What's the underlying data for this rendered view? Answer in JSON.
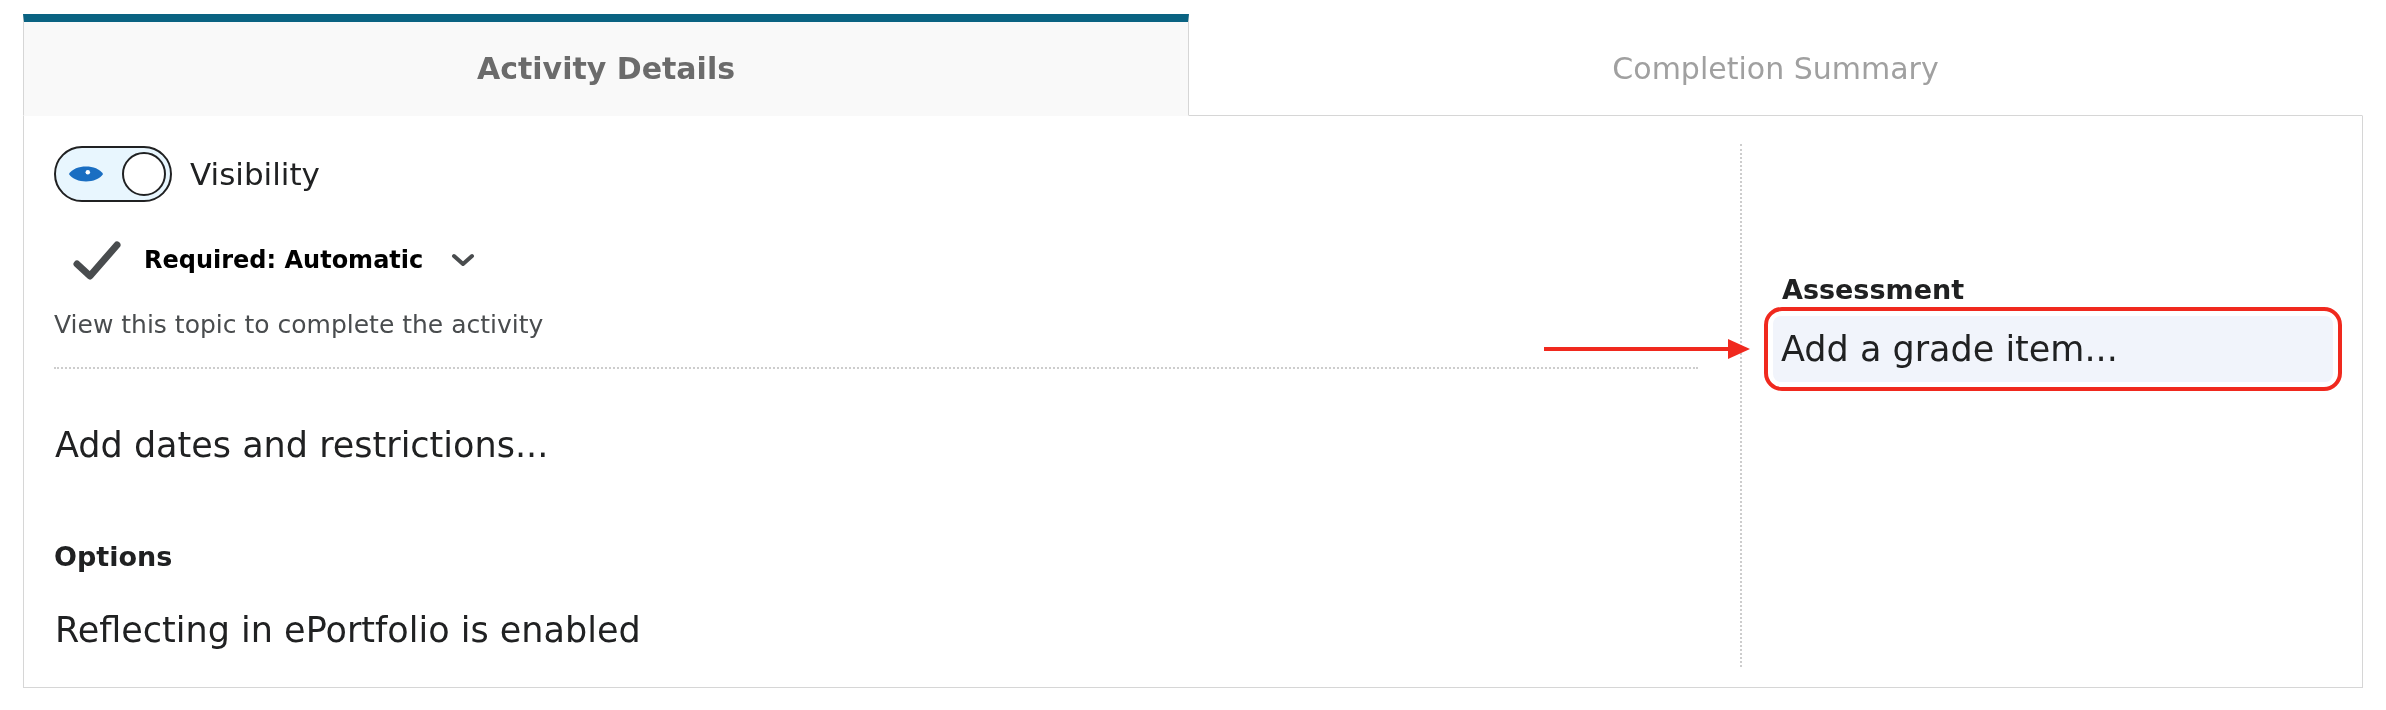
{
  "tabs": [
    {
      "label": "Activity Details",
      "selected": true
    },
    {
      "label": "Completion Summary",
      "selected": false
    }
  ],
  "visibility": {
    "label": "Visibility",
    "on": true
  },
  "completion": {
    "label": "Required: Automatic",
    "checked": true,
    "description": "View this topic to complete the activity"
  },
  "dates_link": "Add dates and restrictions...",
  "options": {
    "heading": "Options",
    "text": "Reflecting in ePortfolio is enabled"
  },
  "assessment": {
    "heading": "Assessment",
    "placeholder": "Add a grade item...",
    "highlighted": true
  }
}
